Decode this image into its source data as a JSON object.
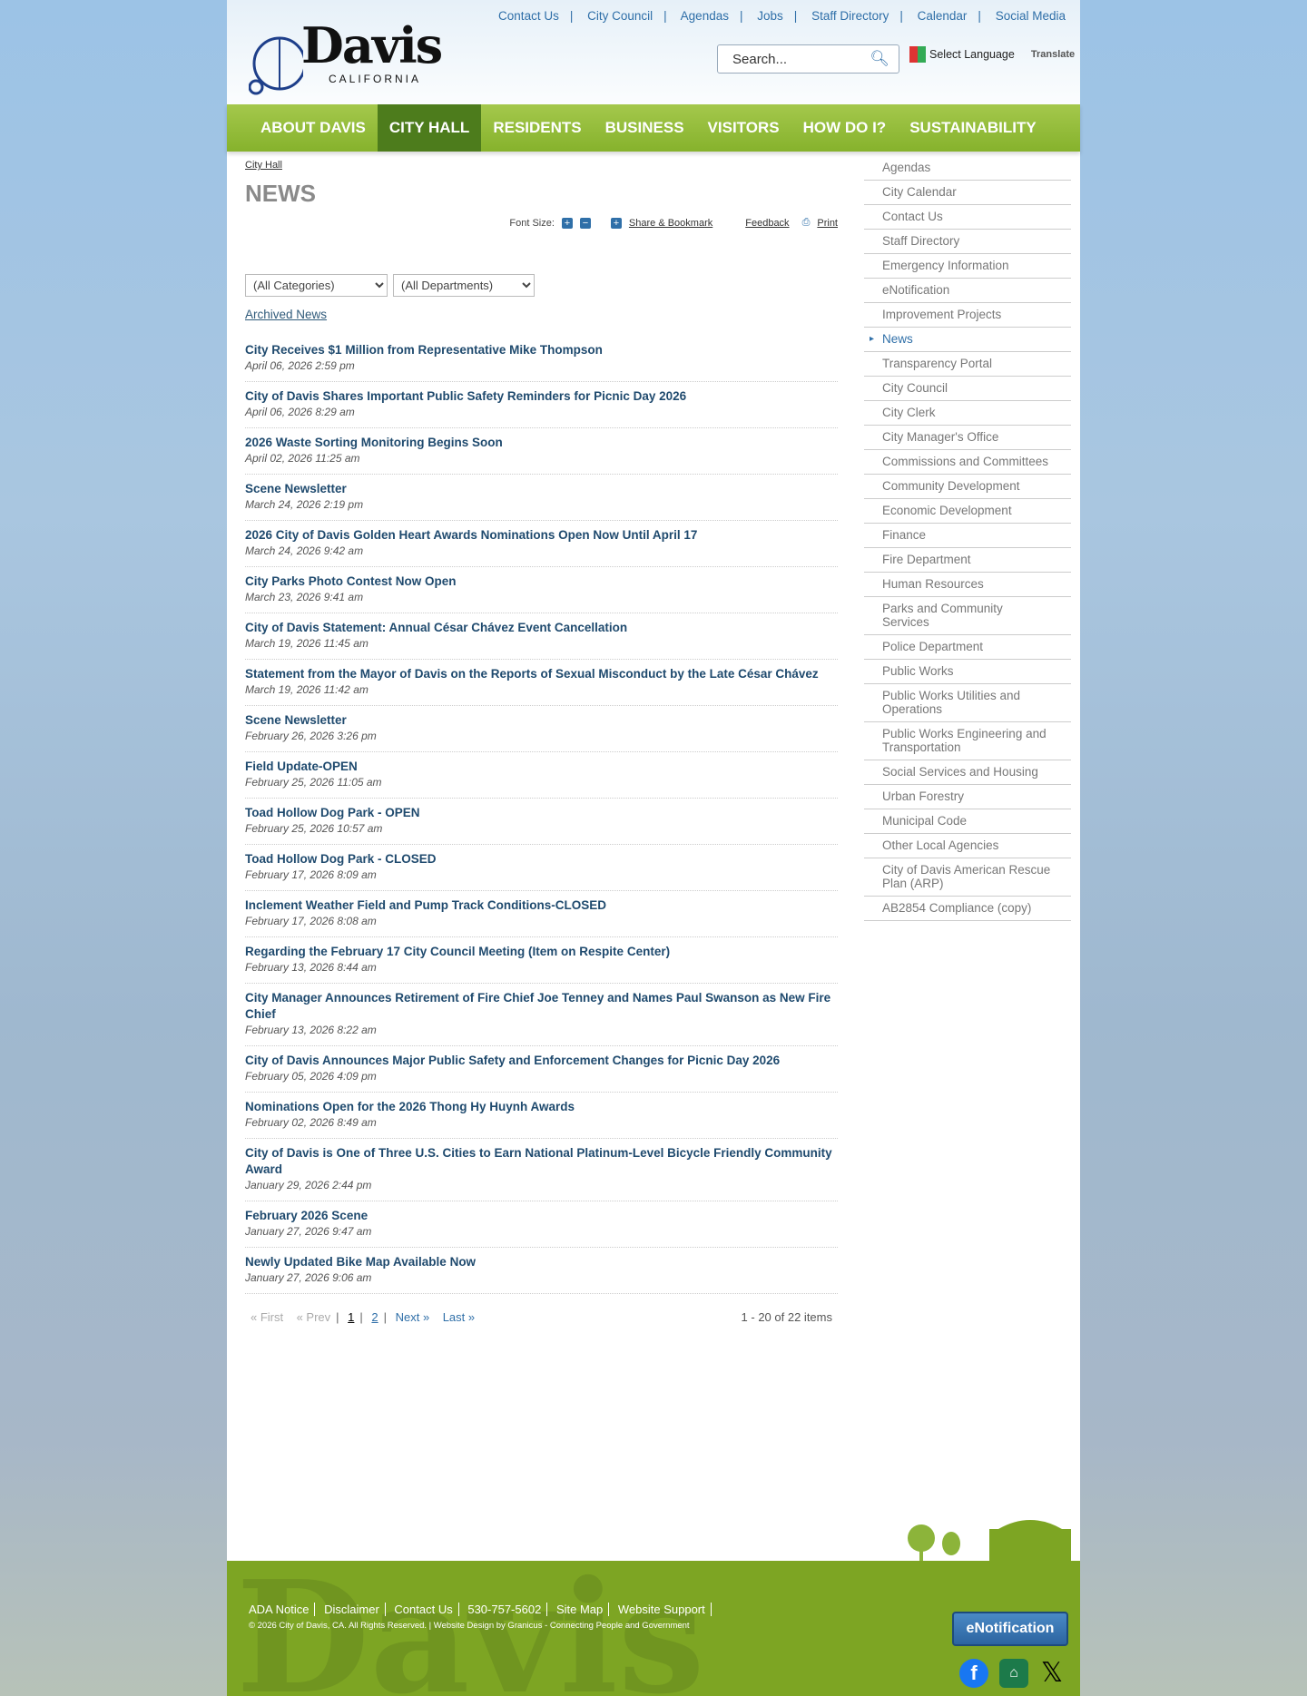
{
  "header": {
    "logo_word": "Davis",
    "logo_sub": "CALIFORNIA",
    "top_links": [
      "Contact Us",
      "City Council",
      "Agendas",
      "Jobs",
      "Staff Directory",
      "Calendar",
      "Social Media"
    ],
    "search_placeholder": "Search...",
    "select_language": "Select Language",
    "translate": "Translate"
  },
  "nav": [
    "ABOUT DAVIS",
    "CITY HALL",
    "RESIDENTS",
    "BUSINESS",
    "VISITORS",
    "HOW DO I?",
    "SUSTAINABILITY"
  ],
  "main": {
    "breadcrumb": "City Hall",
    "title": "NEWS",
    "font_size_label": "Font Size:",
    "share": "Share & Bookmark",
    "feedback": "Feedback",
    "print": "Print",
    "category_select": "(All Categories)",
    "department_select": "(All Departments)",
    "archived": "Archived News",
    "news": [
      {
        "title": "City Receives $1 Million from Representative Mike Thompson",
        "date": "April 06, 2026 2:59 pm"
      },
      {
        "title": "City of Davis Shares Important Public Safety Reminders for Picnic Day 2026",
        "date": "April 06, 2026 8:29 am"
      },
      {
        "title": "2026 Waste Sorting Monitoring Begins Soon",
        "date": "April 02, 2026 11:25 am"
      },
      {
        "title": "Scene Newsletter",
        "date": "March 24, 2026 2:19 pm"
      },
      {
        "title": "2026 City of Davis Golden Heart Awards Nominations Open Now Until April 17",
        "date": "March 24, 2026 9:42 am"
      },
      {
        "title": "City Parks Photo Contest Now Open",
        "date": "March 23, 2026 9:41 am"
      },
      {
        "title": "City of Davis Statement: Annual César Chávez Event Cancellation",
        "date": "March 19, 2026 11:45 am"
      },
      {
        "title": "Statement from the Mayor of Davis on the Reports of Sexual Misconduct by the Late César Chávez",
        "date": "March 19, 2026 11:42 am"
      },
      {
        "title": "Scene Newsletter",
        "date": "February 26, 2026 3:26 pm"
      },
      {
        "title": "Field Update-OPEN",
        "date": "February 25, 2026 11:05 am"
      },
      {
        "title": "Toad Hollow Dog Park - OPEN",
        "date": "February 25, 2026 10:57 am"
      },
      {
        "title": "Toad Hollow Dog Park - CLOSED",
        "date": "February 17, 2026 8:09 am"
      },
      {
        "title": "Inclement Weather Field and Pump Track Conditions-CLOSED",
        "date": "February 17, 2026 8:08 am"
      },
      {
        "title": "Regarding the February 17 City Council Meeting (Item on Respite Center)",
        "date": "February 13, 2026 8:44 am"
      },
      {
        "title": "City Manager Announces Retirement of Fire Chief Joe Tenney and Names Paul Swanson as New Fire Chief",
        "date": "February 13, 2026 8:22 am"
      },
      {
        "title": "City of Davis Announces Major Public Safety and Enforcement Changes for Picnic Day 2026",
        "date": "February 05, 2026 4:09 pm"
      },
      {
        "title": "Nominations Open for the 2026 Thong Hy Huynh Awards",
        "date": "February 02, 2026 8:49 am"
      },
      {
        "title": "City of Davis is One of Three U.S. Cities to Earn National Platinum-Level Bicycle Friendly Community Award",
        "date": "January 29, 2026 2:44 pm"
      },
      {
        "title": "February 2026 Scene",
        "date": "January 27, 2026 9:47 am"
      },
      {
        "title": "Newly Updated Bike Map Available Now",
        "date": "January 27, 2026 9:06 am"
      }
    ],
    "pager": {
      "first": "« First",
      "prev": "« Prev",
      "page1": "1",
      "page2": "2",
      "next": "Next »",
      "last": "Last »",
      "count": "1 - 20 of 22 items"
    }
  },
  "sidebar": {
    "current": "News",
    "items": [
      "Agendas",
      "City Calendar",
      "Contact Us",
      "Staff Directory",
      "Emergency Information",
      "eNotification",
      "Improvement Projects",
      "News",
      "Transparency Portal",
      "City Council",
      "City Clerk",
      "City Manager's Office",
      "Commissions and Committees",
      "Community Development",
      "Economic Development",
      "Finance",
      "Fire Department",
      "Human Resources",
      "Parks and Community Services",
      "Police Department",
      "Public Works",
      "Public Works Utilities and Operations",
      "Public Works Engineering and Transportation",
      "Social Services and Housing",
      "Urban Forestry",
      "Municipal Code",
      "Other Local Agencies",
      "City of Davis American Rescue Plan (ARP)",
      "AB2854 Compliance (copy)"
    ]
  },
  "footer": {
    "links": [
      "ADA Notice",
      "Disclaimer",
      "Contact Us",
      "530-757-5602",
      "Site Map",
      "Website Support"
    ],
    "copyright": "© 2026 City of Davis, CA. All Rights Reserved. | Website Design by Granicus - Connecting People and Government",
    "enotification": "eNotification",
    "watermark": "Davis"
  }
}
